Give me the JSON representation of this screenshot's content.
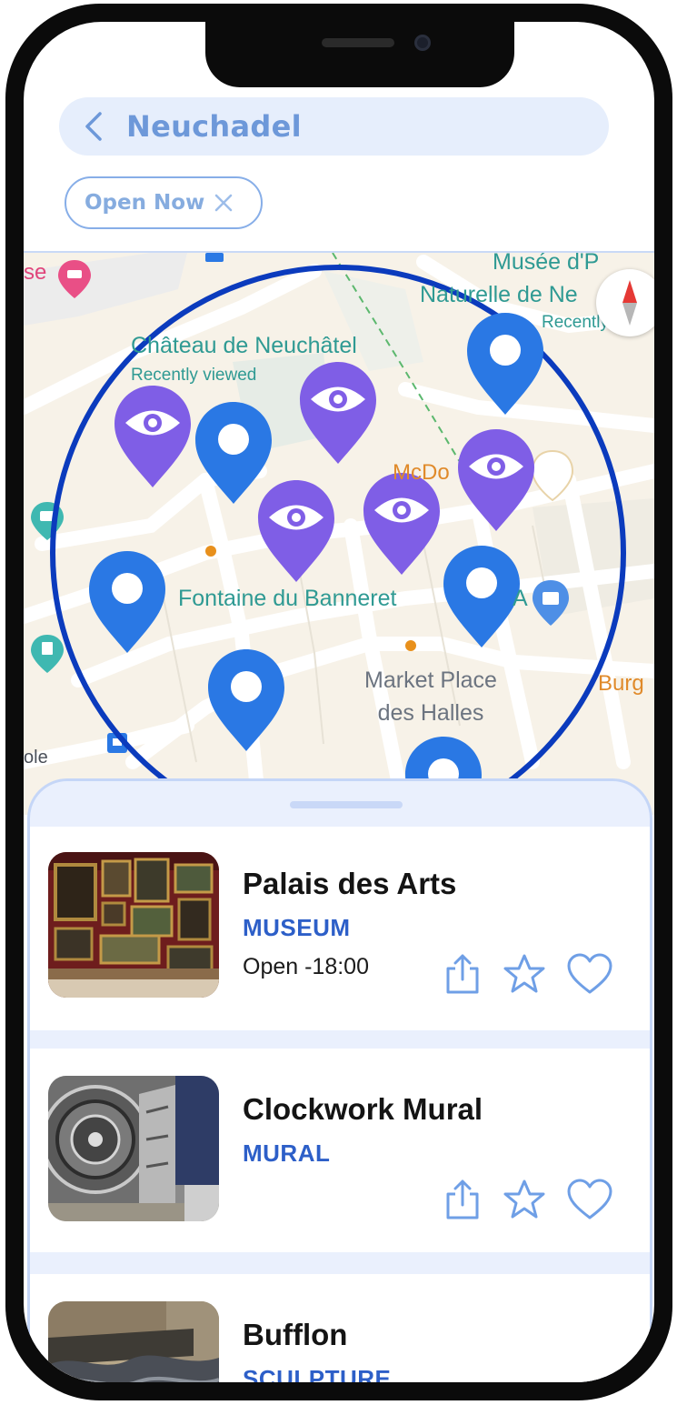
{
  "header": {
    "search_title": "Neuchadel",
    "back_icon": "chevron-left-icon",
    "filter_chip": {
      "label": "Open Now",
      "close_icon": "close-icon"
    }
  },
  "map": {
    "labels": {
      "chateau": "Château de Neuchâtel",
      "chateau_sub": "Recently viewed",
      "musee_line1": "Musée d'P",
      "musee_line2": "Naturelle de Ne",
      "musee_sub": "Recently v",
      "mcdo": "McDo",
      "fontaine": "Fontaine du Banneret",
      "market_line1": "Market Place",
      "market_line2": "des Halles",
      "burg": "Burg",
      "se": "se",
      "ole": "ole",
      "a": "A"
    },
    "search_radius_color": "#0b3bbd",
    "pin_colors": {
      "location": "#2a78e4",
      "viewed": "#7f5ee6"
    },
    "compass_icon": "compass-icon"
  },
  "places": [
    {
      "title": "Palais des Arts",
      "category": "MUSEUM",
      "hours": "Open -18:00"
    },
    {
      "title": "Clockwork Mural",
      "category": "MURAL"
    },
    {
      "title": "Bufflon",
      "category": "SCULPTURE"
    }
  ],
  "actions": {
    "share_icon": "share-icon",
    "star_icon": "star-icon",
    "heart_icon": "heart-icon"
  },
  "colors": {
    "accent": "#2d5fc8",
    "icon_stroke": "#6f9fe6",
    "sheet_bg": "#eaf0fd"
  }
}
